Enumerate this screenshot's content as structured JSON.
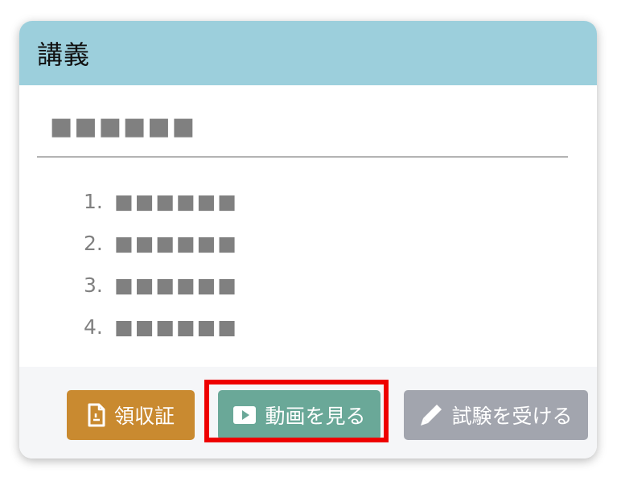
{
  "card": {
    "title": "講義",
    "subtitle": "■■■■■■",
    "lessons": [
      {
        "number": "1.",
        "title": "■■■■■■"
      },
      {
        "number": "2.",
        "title": "■■■■■■"
      },
      {
        "number": "3.",
        "title": "■■■■■■"
      },
      {
        "number": "4.",
        "title": "■■■■■■"
      }
    ]
  },
  "footer": {
    "receipt_label": "領収証",
    "video_label": "動画を見る",
    "exam_label": "試験を受ける"
  },
  "icons": {
    "receipt": "document-icon",
    "video": "play-icon",
    "exam": "pencil-icon"
  },
  "colors": {
    "header_bg": "#9ccfdc",
    "receipt_button": "#c98a30",
    "video_button": "#6aa898",
    "exam_button": "#a2a5ae",
    "highlight": "#ee0000"
  }
}
